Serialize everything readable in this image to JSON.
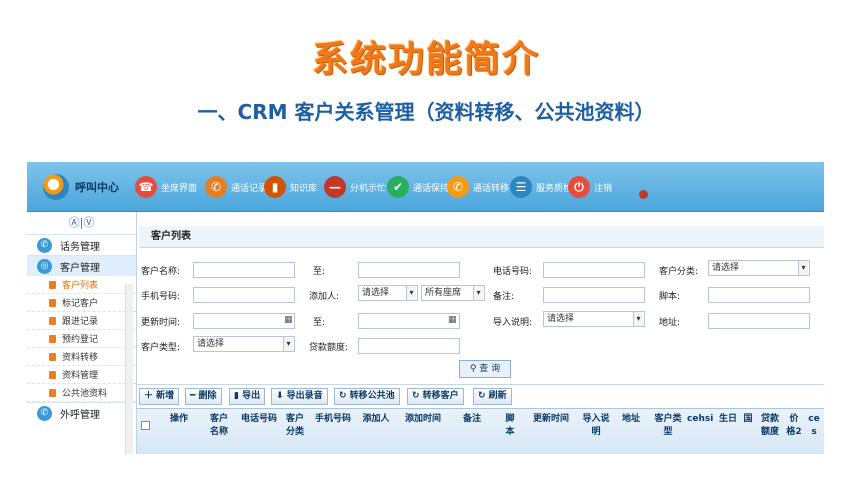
{
  "slide": {
    "title": "系统功能简介",
    "subtitle": "一、CRM 客户关系管理（资料转移、公共池资料）"
  },
  "app": {
    "logo_text": "呼叫中心",
    "toolbar": [
      {
        "name": "seat-interface",
        "label": "坐席界面",
        "icon": "seat-icon",
        "color": "#e74c3c",
        "glyph": "☎"
      },
      {
        "name": "call-records",
        "label": "通话记录",
        "icon": "phone-icon",
        "color": "#e67e22",
        "glyph": "✆"
      },
      {
        "name": "knowledge-base",
        "label": "知识库",
        "icon": "book-icon",
        "color": "#d35400",
        "glyph": "▮"
      },
      {
        "name": "extension-status",
        "label": "分机示忙",
        "icon": "busy-icon",
        "color": "#c0392b",
        "glyph": "—"
      },
      {
        "name": "call-keep",
        "label": "通话保持",
        "icon": "check-icon",
        "color": "#27ae60",
        "glyph": "✔"
      },
      {
        "name": "call-transfer",
        "label": "通话转移",
        "icon": "transfer-icon",
        "color": "#f39c12",
        "glyph": "✆"
      },
      {
        "name": "service-check",
        "label": "服务质检",
        "icon": "list-icon",
        "color": "#2e86c1",
        "glyph": "☰"
      },
      {
        "name": "logout",
        "label": "注销",
        "icon": "power-icon",
        "color": "#e74c3c",
        "glyph": "⏻"
      }
    ],
    "sidebar": {
      "toggle": "Ⓐ|Ⓥ",
      "sections": [
        {
          "label": "话务管理",
          "icon": "phone-icon",
          "active": false
        },
        {
          "label": "客户管理",
          "icon": "globe-icon",
          "active": true
        }
      ],
      "items": [
        "客户列表",
        "标记客户",
        "跟进记录",
        "预约登记",
        "资料转移",
        "资料管理",
        "公共池资料"
      ],
      "bottom_section": "外呼管理"
    },
    "panel_title": "客户列表",
    "form": {
      "customer_name": "客户名称:",
      "to1": "至:",
      "phone": "电话号码:",
      "category": "客户分类:",
      "category_value": "请选择",
      "mobile": "手机号码:",
      "adder": "添加人:",
      "adder_value": "请选择",
      "seat_value": "所有座席",
      "remark": "备注:",
      "script": "脚本:",
      "update_time": "更新时间:",
      "to2": "至:",
      "import_desc": "导入说明:",
      "import_value": "请选择",
      "address": "地址:",
      "customer_type": "客户类型:",
      "type_value": "请选择",
      "loan_limit": "贷款额度:",
      "search": "查 询"
    },
    "buttons": [
      "＋ 新增",
      "━ 删除",
      "▮ 导出",
      "⬇ 导出录音",
      "↻ 转移公共池",
      "↻ 转移客户",
      "↻ 刷新"
    ],
    "columns": [
      "操作",
      "客户\n名称",
      "电话号码",
      "客户\n分类",
      "手机号码",
      "添加人",
      "添加时间",
      "备注",
      "脚\n本",
      "更新时间",
      "导入说\n明",
      "地址",
      "客户类\n型",
      "cehsi",
      "生日",
      "国",
      "贷款\n额度",
      "价\n格2",
      "ce\ns"
    ]
  }
}
